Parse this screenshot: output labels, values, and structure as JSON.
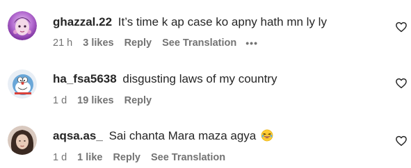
{
  "comments": [
    {
      "username": "ghazzal.22",
      "text": "It’s time k ap case ko apny hath mn ly ly",
      "time": "21 h",
      "likes": "3 likes",
      "reply": "Reply",
      "see_translation": "See Translation",
      "more": "•••",
      "avatar_icon": "avatar-pink-filter-icon"
    },
    {
      "username": "ha_fsa5638",
      "text": "disgusting laws of my country",
      "time": "1 d",
      "likes": "19 likes",
      "reply": "Reply",
      "avatar_icon": "avatar-cartoon-robot-icon"
    },
    {
      "username": "aqsa.as_",
      "text": "Sai chanta Mara maza agya",
      "emoji": "laughing-emoji-icon",
      "time": "1 d",
      "likes": "1 like",
      "reply": "Reply",
      "see_translation": "See Translation",
      "avatar_icon": "avatar-photo-icon"
    }
  ],
  "colors": {
    "text": "#262626",
    "meta": "#737373",
    "background": "#ffffff"
  }
}
